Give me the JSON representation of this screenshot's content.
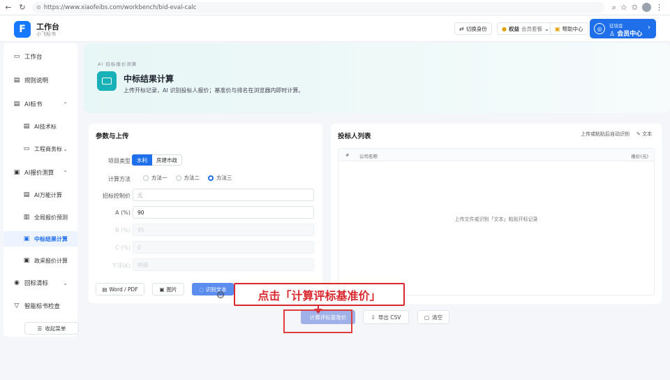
{
  "browser": {
    "url": "https://www.xiaofeibs.com/workbench/bid-eval-calc"
  },
  "header": {
    "app_title": "工作台",
    "app_sub": "小飞标书",
    "switch_identity": "切换身份",
    "rights_label": "权益",
    "rights_value": "会员套餐",
    "help_center": "帮助中心",
    "member_sub": "征钱金",
    "member_main": "会员中心"
  },
  "sidebar": {
    "items": [
      {
        "label": "工作台",
        "icon": "monitor-icon"
      },
      {
        "label": "规则说明",
        "icon": "doc-icon"
      },
      {
        "label": "AI标书",
        "icon": "doc-icon"
      },
      {
        "label": "AI技术标",
        "icon": "doc-icon"
      },
      {
        "label": "工程商务标",
        "icon": "folder-icon"
      },
      {
        "label": "AI报价测算",
        "icon": "calc-icon"
      },
      {
        "label": "AI万能计算",
        "icon": "doc-icon"
      },
      {
        "label": "全局报价预测",
        "icon": "chart-icon"
      },
      {
        "label": "中标结果计算",
        "icon": "calc-icon"
      },
      {
        "label": "政采报价计算",
        "icon": "calc-icon"
      },
      {
        "label": "回标清标",
        "icon": "search-icon"
      },
      {
        "label": "智能标书检查",
        "icon": "filter-icon"
      }
    ],
    "menu_button": "收起菜单"
  },
  "banner": {
    "crumb": "AI 招标报价测算",
    "title": "中标结果计算",
    "desc": "上传开标记录，AI 识别投标人报价；基准价与排名在浏览器内即时计算。"
  },
  "params": {
    "title": "参数与上传",
    "project_type_label": "项目类型",
    "type_options": [
      "水利",
      "房建市政"
    ],
    "method_label": "计算方法",
    "methods": [
      "方法一",
      "方法二",
      "方法三"
    ],
    "control_price_label": "招标控制价",
    "control_price_placeholder": "元",
    "a_label": "A (%)",
    "a_value": "90",
    "b_label": "B (%)",
    "b_value": "95",
    "c_label": "C (%)",
    "c_value": "0",
    "k_label": "下浮(K)",
    "k_value": "明细",
    "buttons": [
      "Word / PDF",
      "图片",
      "识别文本"
    ]
  },
  "bidders": {
    "title": "投标人列表",
    "upload_link": "上传或粘贴后自动识别",
    "text_link": "文本",
    "col_index": "#",
    "col_company": "公司名称",
    "col_price": "报价(元)",
    "empty_text": "上传文件或识别「文本」粘贴开标记录"
  },
  "actions": {
    "calculate": "计算评标基准价",
    "export": "导出 CSV",
    "clear": "清空"
  },
  "callout": {
    "text": "点击「计算评标基准价」"
  },
  "colors": {
    "primary": "#1f6feb",
    "accent_teal": "#18b1b8",
    "callout_red": "#d9272e"
  }
}
